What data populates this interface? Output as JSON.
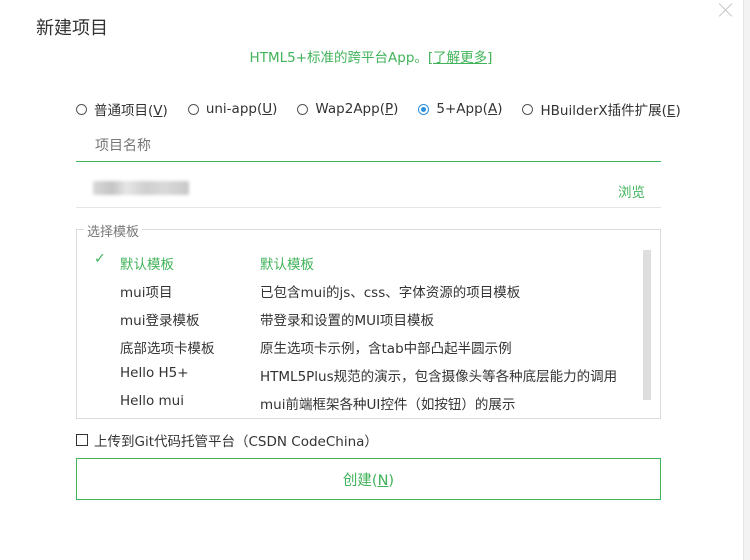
{
  "dialog": {
    "title": "新建项目",
    "subtitle_text": "HTML5+标准的跨平台App。",
    "subtitle_link": "[了解更多]"
  },
  "project_types": [
    {
      "label": "普通项目(",
      "key": "V",
      "checked": false
    },
    {
      "label": "uni-app(",
      "key": "U",
      "checked": false
    },
    {
      "label": "Wap2App(",
      "key": "P",
      "checked": false
    },
    {
      "label": "5+App(",
      "key": "A",
      "checked": true
    },
    {
      "label": "HBuilderX插件扩展(",
      "key": "E",
      "checked": false
    }
  ],
  "name_field": {
    "placeholder": "项目名称",
    "value": ""
  },
  "path_field": {
    "browse_label": "浏览"
  },
  "templates": {
    "legend": "选择模板",
    "items": [
      {
        "name": "默认模板",
        "desc": "默认模板",
        "selected": true
      },
      {
        "name": "mui项目",
        "desc": "已包含mui的js、css、字体资源的项目模板",
        "selected": false
      },
      {
        "name": "mui登录模板",
        "desc": "带登录和设置的MUI项目模板",
        "selected": false
      },
      {
        "name": "底部选项卡模板",
        "desc": "原生选项卡示例，含tab中部凸起半圆示例",
        "selected": false
      },
      {
        "name": "Hello H5+",
        "desc": "HTML5Plus规范的演示，包含摄像头等各种底层能力的调用",
        "selected": false
      },
      {
        "name": "Hello mui",
        "desc": "mui前端框架各种UI控件（如按钮）的展示",
        "selected": false
      }
    ]
  },
  "git_upload": {
    "label": "上传到Git代码托管平台（CSDN CodeChina）",
    "checked": false
  },
  "create_button": {
    "label_prefix": "创建(",
    "key": "N",
    "label_suffix": ")"
  },
  "colors": {
    "accent": "#41b35a",
    "radio_checked": "#2b8fde"
  },
  "icons": {
    "close": "close-icon",
    "check": "check-icon"
  }
}
